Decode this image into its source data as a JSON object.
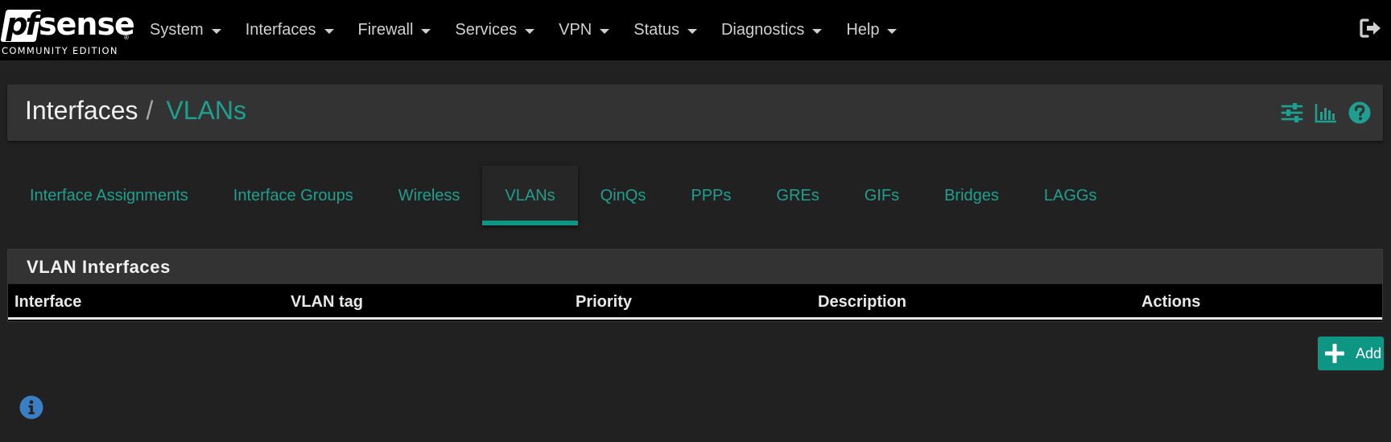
{
  "brand": {
    "logo_text_pf": "pf",
    "logo_text_sense": "sense",
    "edition": "COMMUNITY EDITION"
  },
  "nav": {
    "items": [
      {
        "label": "System"
      },
      {
        "label": "Interfaces"
      },
      {
        "label": "Firewall"
      },
      {
        "label": "Services"
      },
      {
        "label": "VPN"
      },
      {
        "label": "Status"
      },
      {
        "label": "Diagnostics"
      },
      {
        "label": "Help"
      }
    ],
    "logout_icon": "sign-out-icon"
  },
  "breadcrumb": {
    "parent": "Interfaces",
    "separator": "/",
    "current": "VLANs"
  },
  "header_icons": [
    "sliders-icon",
    "bar-chart-icon",
    "question-circle-icon"
  ],
  "tabs": [
    {
      "label": "Interface Assignments",
      "active": false
    },
    {
      "label": "Interface Groups",
      "active": false
    },
    {
      "label": "Wireless",
      "active": false
    },
    {
      "label": "VLANs",
      "active": true
    },
    {
      "label": "QinQs",
      "active": false
    },
    {
      "label": "PPPs",
      "active": false
    },
    {
      "label": "GREs",
      "active": false
    },
    {
      "label": "GIFs",
      "active": false
    },
    {
      "label": "Bridges",
      "active": false
    },
    {
      "label": "LAGGs",
      "active": false
    }
  ],
  "table": {
    "title": "VLAN Interfaces",
    "columns": [
      "Interface",
      "VLAN tag",
      "Priority",
      "Description",
      "Actions"
    ],
    "rows": []
  },
  "actions": {
    "add_label": "Add",
    "add_icon": "plus-icon"
  },
  "info_icon": "info-circle-icon",
  "colors": {
    "accent": "#1e9f8f",
    "button": "#0e9685",
    "info": "#3a7fc4",
    "background": "#212121",
    "navbar": "#000000"
  }
}
